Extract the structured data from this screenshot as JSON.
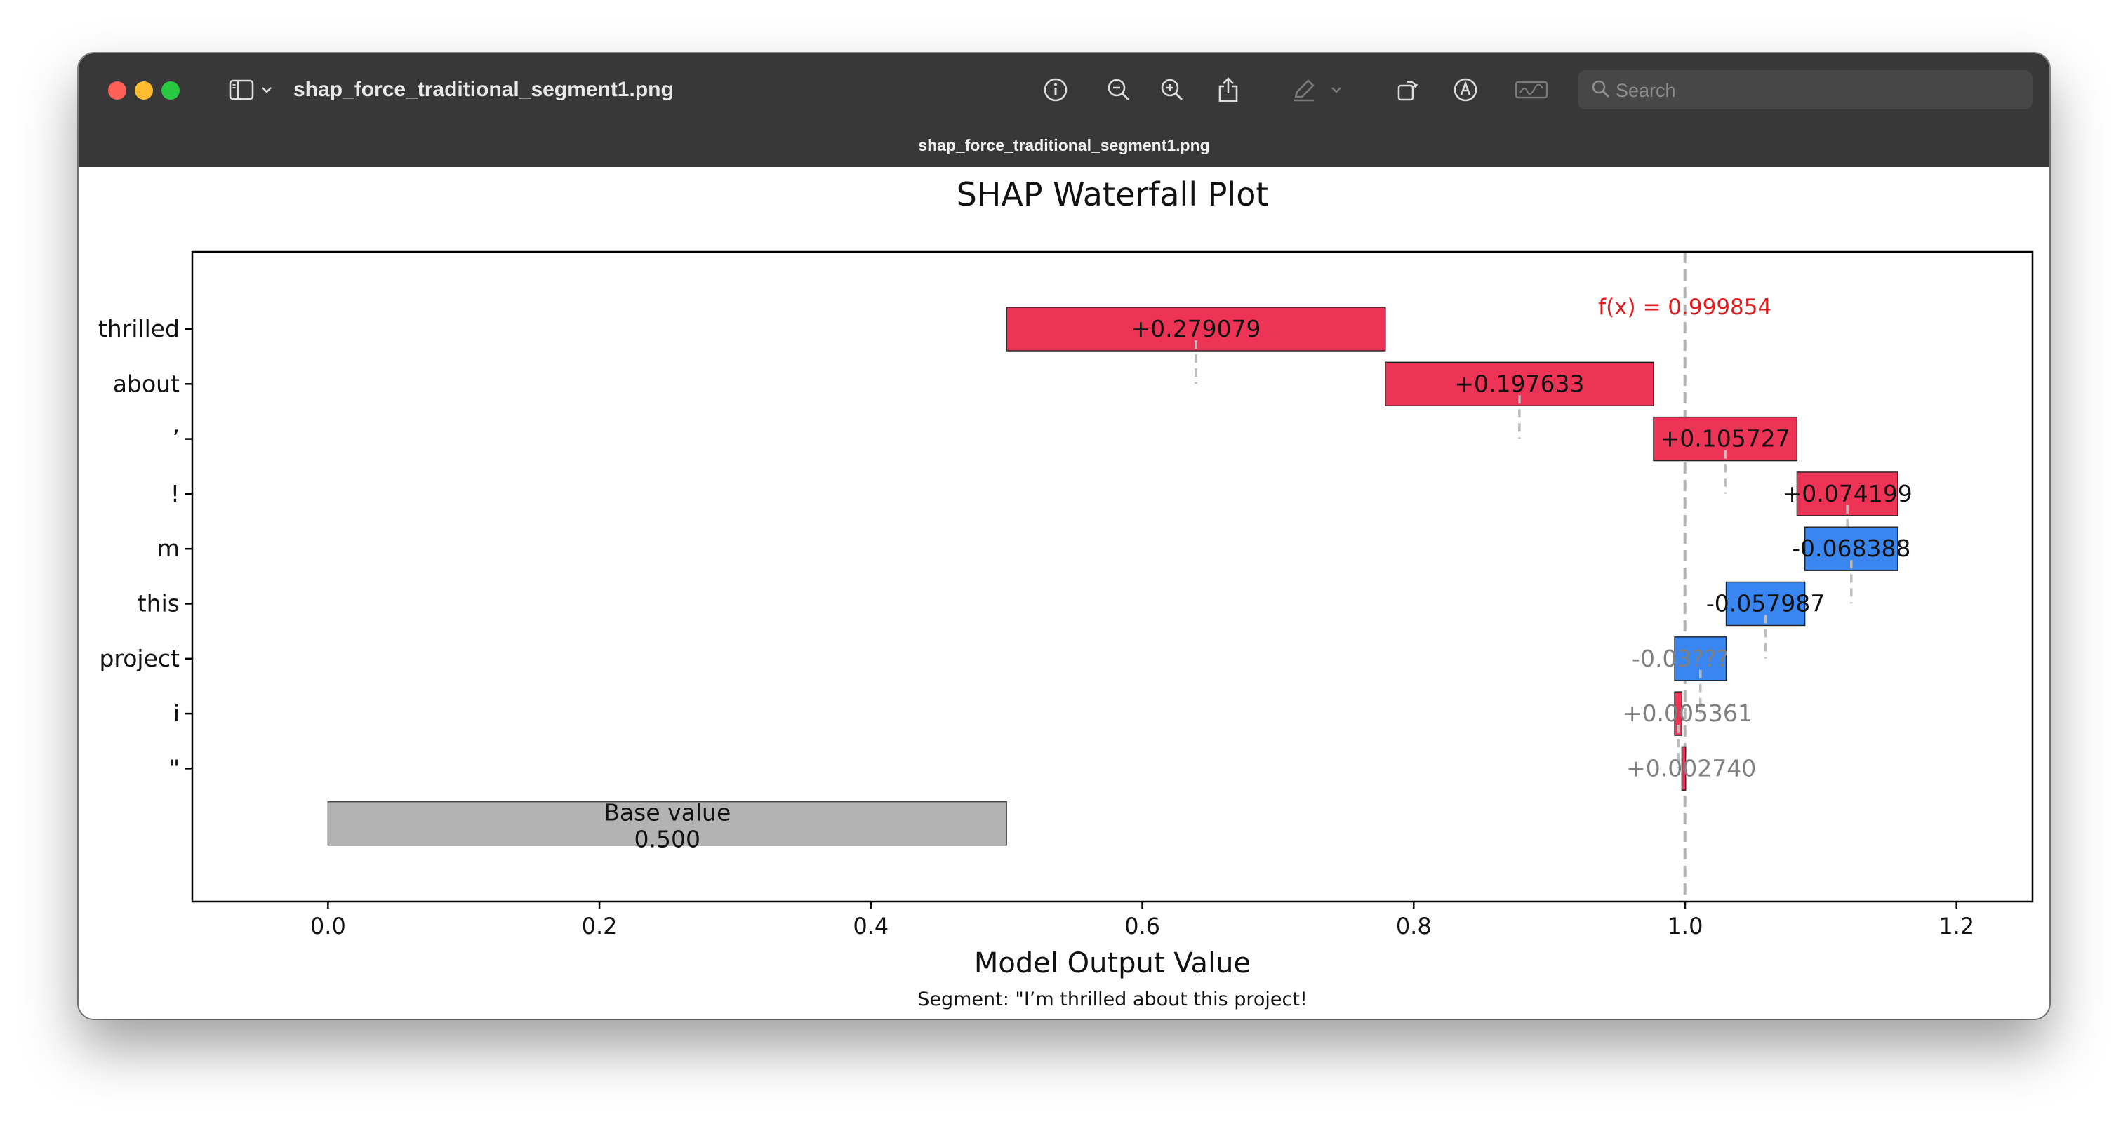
{
  "window": {
    "document_title": "shap_force_traditional_segment1.png",
    "tab_title": "shap_force_traditional_segment1.png",
    "search_placeholder": "Search"
  },
  "toolbar": {
    "icons": [
      "sidebar-toggle-icon",
      "chevron-down-icon",
      "info-icon",
      "zoom-out-icon",
      "zoom-in-icon",
      "share-icon",
      "markup-pen-icon",
      "chevron-down-icon",
      "rotate-icon",
      "markup-circle-icon",
      "signature-icon",
      "search-icon"
    ]
  },
  "colors": {
    "positive": "#ee3456",
    "negative": "#3a86f0",
    "base": "#b3b3b3",
    "fx_label": "#e31a1c",
    "titlebar": "#383838"
  },
  "chart_data": {
    "type": "bar",
    "subtype": "waterfall",
    "title": "SHAP Waterfall Plot",
    "xlabel": "Model Output Value",
    "caption": "Segment: \"I’m thrilled about this project!",
    "xlim": [
      -0.1,
      1.256
    ],
    "xticks": [
      "0.0",
      "0.2",
      "0.4",
      "0.6",
      "0.8",
      "1.0",
      "1.2"
    ],
    "xtick_values": [
      0.0,
      0.2,
      0.4,
      0.6,
      0.8,
      1.0,
      1.2
    ],
    "base_value": 0.5,
    "base_label": "Base value",
    "base_value_text": "0.500",
    "final_value": 0.999854,
    "fx_label": "f(x) = 0.999854",
    "features": [
      {
        "name": "thrilled",
        "value": 0.279079,
        "start": 0.5,
        "label": "+0.279079"
      },
      {
        "name": "about",
        "value": 0.197633,
        "start": 0.779079,
        "label": "+0.197633"
      },
      {
        "name": "’",
        "value": 0.105727,
        "start": 0.976712,
        "label": "+0.105727"
      },
      {
        "name": "!",
        "value": 0.074199,
        "start": 1.082439,
        "label": "+0.074199"
      },
      {
        "name": "m",
        "value": -0.068388,
        "start": 1.156638,
        "label": "-0.068388"
      },
      {
        "name": "this",
        "value": -0.057987,
        "start": 1.08825,
        "label": "-0.057987"
      },
      {
        "name": "project",
        "value": -0.038,
        "start": 1.030263,
        "label": "-0.03???"
      },
      {
        "name": "i",
        "value": 0.005361,
        "start": 0.992253,
        "label": "+0.005361"
      },
      {
        "name": "\"",
        "value": 0.00274,
        "start": 0.997614,
        "label": "+0.002740"
      }
    ]
  }
}
